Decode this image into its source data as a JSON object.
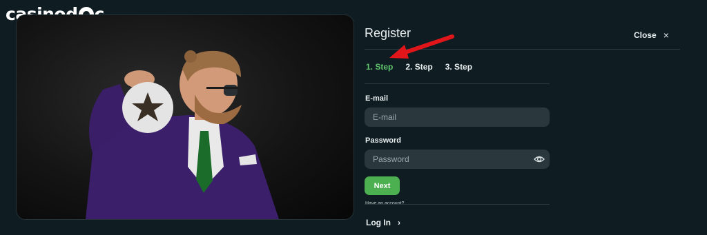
{
  "brand": {
    "logo_text_1": "casino",
    "logo_text_2": "d",
    "logo_text_3": "c"
  },
  "register": {
    "title": "Register",
    "close_label": "Close",
    "close_icon": "×",
    "steps": [
      {
        "label": "1. Step",
        "active": true
      },
      {
        "label": "2. Step",
        "active": false
      },
      {
        "label": "3. Step",
        "active": false
      }
    ],
    "email": {
      "label": "E-mail",
      "placeholder": "E-mail"
    },
    "password": {
      "label": "Password",
      "placeholder": "Password",
      "icon": "eye-icon"
    },
    "next_label": "Next",
    "have_account_text": "Have an account?",
    "login_label": "Log In",
    "login_icon": "›"
  },
  "colors": {
    "background": "#0f1d22",
    "accent_green": "#4caf50",
    "active_step": "#5fc46b",
    "field_bg": "#2a383d",
    "annotation_arrow": "#e0161b"
  }
}
